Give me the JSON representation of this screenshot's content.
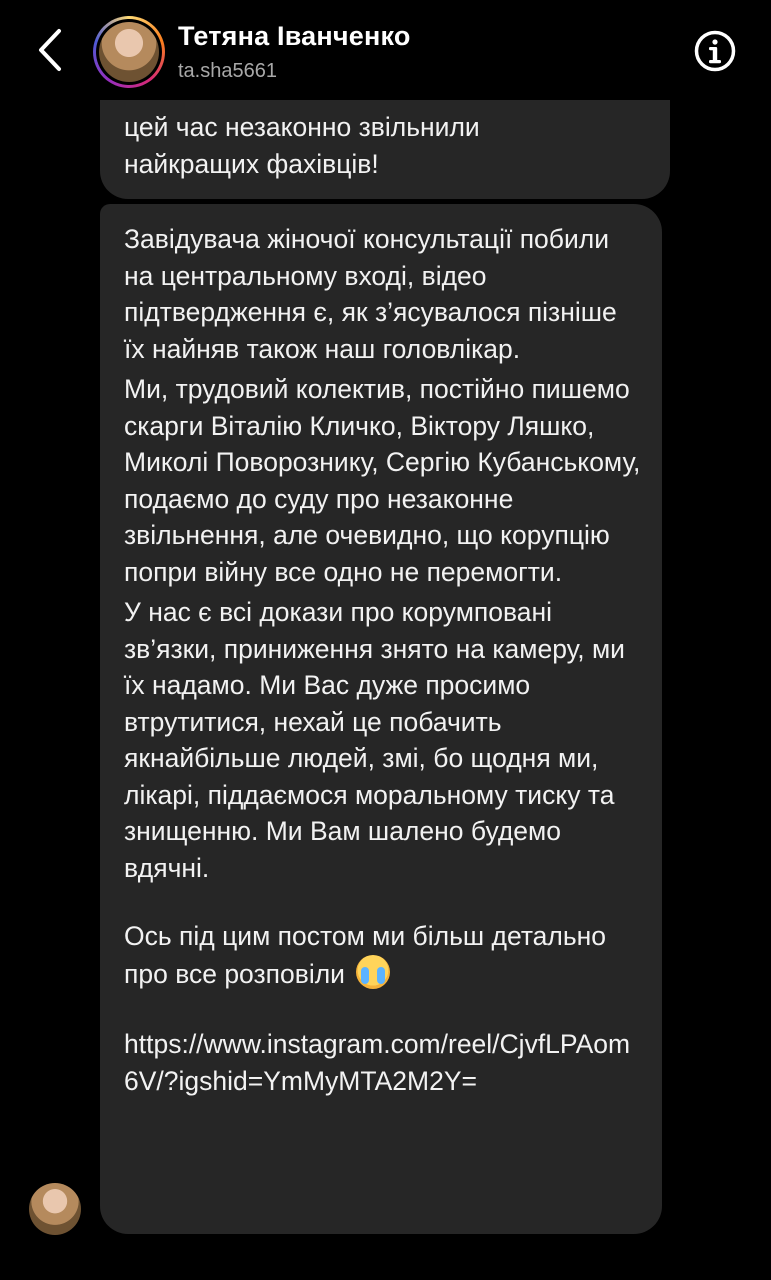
{
  "header": {
    "name": "Тетяна Іванченко",
    "handle": "ta.sha5661",
    "back_icon": "chevron-left-icon",
    "info_icon": "info-icon"
  },
  "messages": [
    {
      "lines": [
        "цей час незаконно звільнили",
        "найкращих фахівців!"
      ]
    },
    {
      "paragraphs": [
        "Завідувача жіночої консультації побили на центральному вході, відео підтвердження є, як з’ясувалося пізніше їх найняв також наш головлікар.",
        "Ми, трудовий колектив, постійно пишемо скарги Віталію Кличко, Віктору Ляшко, Миколі Поворознику, Сергію Кубанському, подаємо до суду про незаконне звільнення, але очевидно, що корупцію попри війну все одно не перемогти.",
        "У нас є всі докази про корумповані зв’язки, приниження знято на камеру, ми їх надамо. Ми Вас дуже просимо втрутитися, нехай це побачить якнайбільше людей, змі, бо щодня ми, лікарі, піддаємося моральному тиску та знищенню. Ми Вам шалено будемо вдячні.",
        "Ось під цим постом ми більш детально про все розповіли"
      ],
      "emoji": "crying-face-emoji",
      "link": "https://www.instagram.com/reel/CjvfLPAom6V/?igshid=YmMyMTA2M2Y="
    }
  ]
}
